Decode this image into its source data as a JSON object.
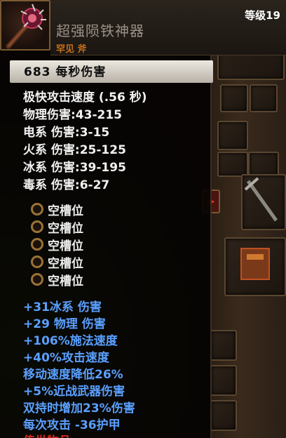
{
  "item": {
    "name": "超强陨铁神器",
    "rarity_type": "罕见 斧",
    "level": "等级19",
    "dps": "683  每秒伤害"
  },
  "base_stats": [
    "极快攻击速度 (.56 秒)",
    "物理伤害:43-215",
    "电系 伤害:3-15",
    "火系 伤害:25-125",
    "冰系 伤害:39-195",
    "毒系 伤害:6-27"
  ],
  "sockets": [
    {
      "label": "空槽位"
    },
    {
      "label": "空槽位"
    },
    {
      "label": "空槽位"
    },
    {
      "label": "空槽位"
    },
    {
      "label": "空槽位"
    }
  ],
  "magic_stats": [
    "+31冰系 伤害",
    "+29 物理 伤害",
    "+106%施法速度",
    "+40%攻击速度",
    "移动速度降低26%",
    "+5%近战武器伤害",
    "双持时增加23%伤害",
    "每次攻击 -36护甲"
  ],
  "trailing_red_text": "传世物品",
  "colors": {
    "magic_blue": "#5aa0ff",
    "rarity_orange": "#c4701e",
    "negative_red": "#d22a22"
  },
  "icons": {
    "item": "spiked-axe-icon",
    "socket": "empty-socket-ring-icon",
    "arrow": "red-arrow-icon"
  }
}
